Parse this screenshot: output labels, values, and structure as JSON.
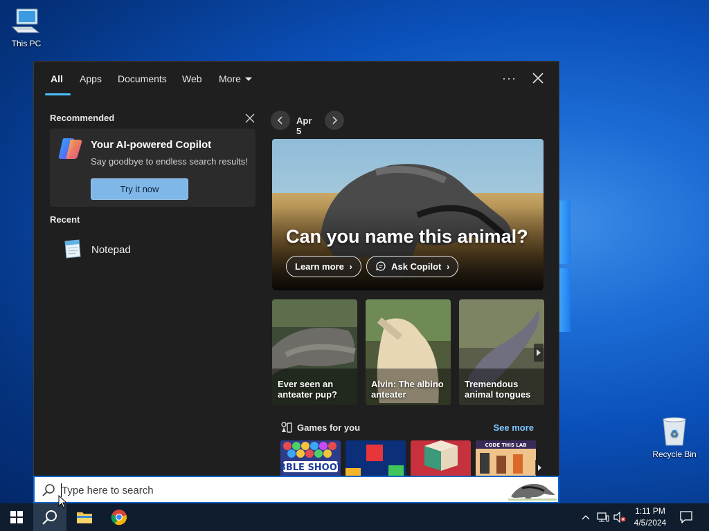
{
  "desktop": {
    "this_pc_label": "This PC",
    "recycle_bin_label": "Recycle Bin"
  },
  "search_panel": {
    "tabs": [
      {
        "label": "All",
        "active": true
      },
      {
        "label": "Apps"
      },
      {
        "label": "Documents"
      },
      {
        "label": "Web"
      },
      {
        "label": "More"
      }
    ],
    "more_options_label": "···",
    "recommended": {
      "heading": "Recommended",
      "card_title": "Your AI-powered Copilot",
      "card_subtitle": "Say goodbye to endless search results!",
      "card_button": "Try it now"
    },
    "recent": {
      "heading": "Recent",
      "items": [
        {
          "label": "Notepad",
          "icon": "notepad-icon"
        }
      ]
    },
    "highlights": {
      "date": "Apr 5",
      "hero_title": "Can you name this animal?",
      "hero_buttons": [
        "Learn more",
        "Ask Copilot"
      ],
      "cards": [
        {
          "label": "Ever seen an anteater pup?"
        },
        {
          "label": "Alvin: The albino anteater"
        },
        {
          "label": "Tremendous animal tongues"
        }
      ],
      "games_heading": "Games for you",
      "games_see_more": "See more",
      "games": [
        {
          "label": "BUBBLE SHOOTER"
        },
        {
          "label": "Blocks"
        },
        {
          "label": "Cubes"
        },
        {
          "label": "CODE THIS LAB"
        }
      ]
    }
  },
  "search_box": {
    "placeholder": "Type here to search",
    "value": ""
  },
  "taskbar": {
    "time": "1:11 PM",
    "date": "4/5/2024"
  },
  "colors": {
    "accent": "#4cc2ff",
    "link": "#7cc6ff",
    "panel_bg": "#1f1f1f",
    "search_border": "#0a64c8"
  }
}
